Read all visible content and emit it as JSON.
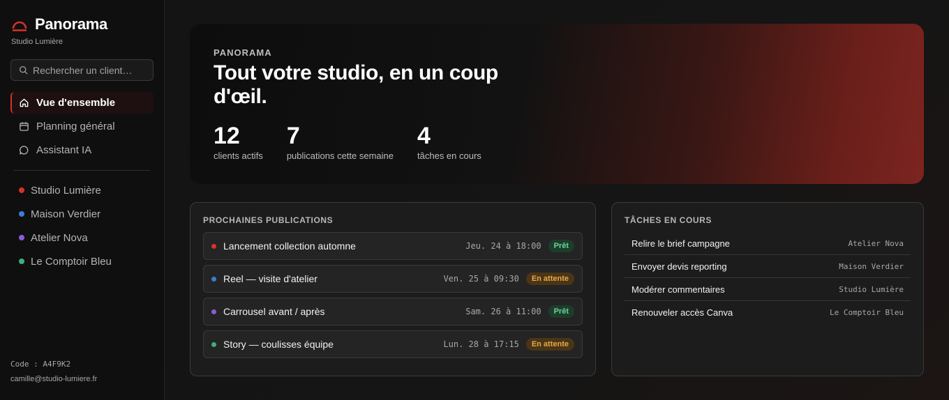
{
  "brand": {
    "name": "Panorama",
    "subtitle": "Studio Lumière",
    "accent": "#d9302a"
  },
  "search": {
    "placeholder": "Rechercher un client…"
  },
  "nav": [
    {
      "label": "Vue d'ensemble",
      "icon": "home-icon",
      "active": true
    },
    {
      "label": "Planning général",
      "icon": "calendar-icon",
      "active": false
    },
    {
      "label": "Assistant IA",
      "icon": "chat-icon",
      "active": false
    }
  ],
  "clients": [
    {
      "name": "Studio Lumière",
      "color": "#d9302a"
    },
    {
      "name": "Maison Verdier",
      "color": "#3b7dd8"
    },
    {
      "name": "Atelier Nova",
      "color": "#8a5cd6"
    },
    {
      "name": "Le Comptoir Bleu",
      "color": "#3fae7a"
    }
  ],
  "footer": {
    "code": "Code : A4F9K2",
    "email": "camille@studio-lumiere.fr"
  },
  "hero": {
    "eyebrow": "PANORAMA",
    "title": "Tout votre studio, en un coup d'œil.",
    "stats": [
      {
        "value": "12",
        "label": "clients actifs"
      },
      {
        "value": "7",
        "label": "publications cette semaine"
      },
      {
        "value": "4",
        "label": "tâches en cours"
      }
    ]
  },
  "publications": {
    "title": "PROCHAINES PUBLICATIONS",
    "items": [
      {
        "title": "Lancement collection automne",
        "date": "Jeu. 24 à 18:00",
        "status": "Prêt",
        "kind": "ready",
        "color": "#d9302a"
      },
      {
        "title": "Reel — visite d'atelier",
        "date": "Ven. 25 à 09:30",
        "status": "En attente",
        "kind": "wait",
        "color": "#3b7dd8"
      },
      {
        "title": "Carrousel avant / après",
        "date": "Sam. 26 à 11:00",
        "status": "Prêt",
        "kind": "ready",
        "color": "#8a5cd6"
      },
      {
        "title": "Story — coulisses équipe",
        "date": "Lun. 28 à 17:15",
        "status": "En attente",
        "kind": "wait",
        "color": "#3fae7a"
      }
    ]
  },
  "tasks": {
    "title": "TÂCHES EN COURS",
    "items": [
      {
        "title": "Relire le brief campagne",
        "client": "Atelier Nova"
      },
      {
        "title": "Envoyer devis reporting",
        "client": "Maison Verdier"
      },
      {
        "title": "Modérer commentaires",
        "client": "Studio Lumière"
      },
      {
        "title": "Renouveler accès Canva",
        "client": "Le Comptoir Bleu"
      }
    ]
  }
}
